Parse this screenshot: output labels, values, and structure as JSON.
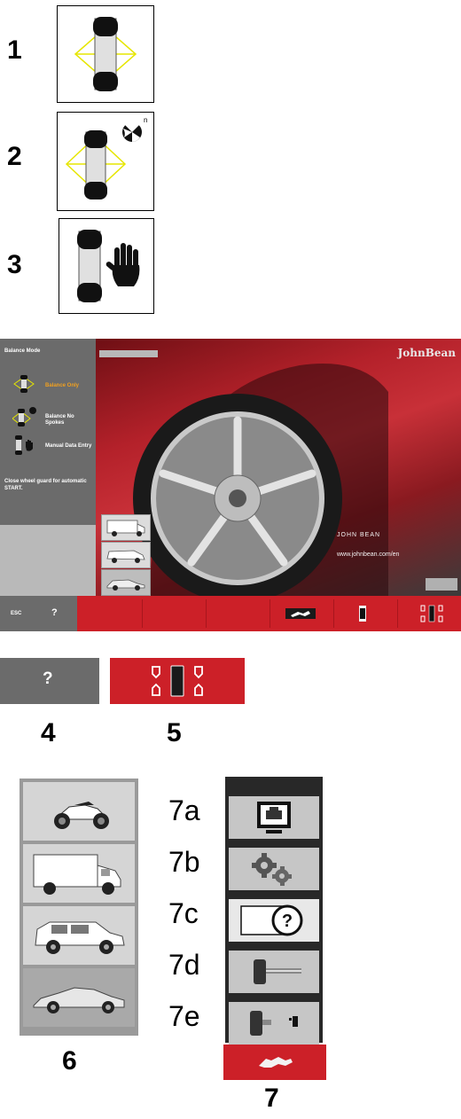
{
  "legend": {
    "n1": "1",
    "n2": "2",
    "n3": "3",
    "n4": "4",
    "n5": "5",
    "n6": "6",
    "n7": "7",
    "n7a": "7a",
    "n7b": "7b",
    "n7c": "7c",
    "n7d": "7d",
    "n7e": "7e",
    "spoke_superscript": "n"
  },
  "screen": {
    "sidebar": {
      "title": "Balance Mode",
      "options": [
        {
          "label": "Balance Only",
          "selected": true,
          "icon": "balance-only-icon"
        },
        {
          "label": "Balance No Spokes",
          "selected": false,
          "icon": "balance-no-spokes-icon"
        },
        {
          "label": "Manual Data Entry",
          "selected": false,
          "icon": "manual-data-entry-icon"
        }
      ],
      "message": "Close wheel guard for automatic START."
    },
    "brand": "JohnBean",
    "brand_caption": "JOHN BEAN",
    "url": "www.johnbean.com/en",
    "bottombar": {
      "esc_label": "ESC",
      "help_label": "?",
      "icons": [
        "wrench-icon",
        "wheel-single-icon",
        "wheel-cross-section-icon"
      ]
    }
  },
  "buttons": {
    "help_label": "?"
  },
  "colors": {
    "accent_red": "#cc2028",
    "sidebar_gray": "#6b6b6b",
    "selected_orange": "#f0a020",
    "plane_yellow": "#e6e600"
  }
}
